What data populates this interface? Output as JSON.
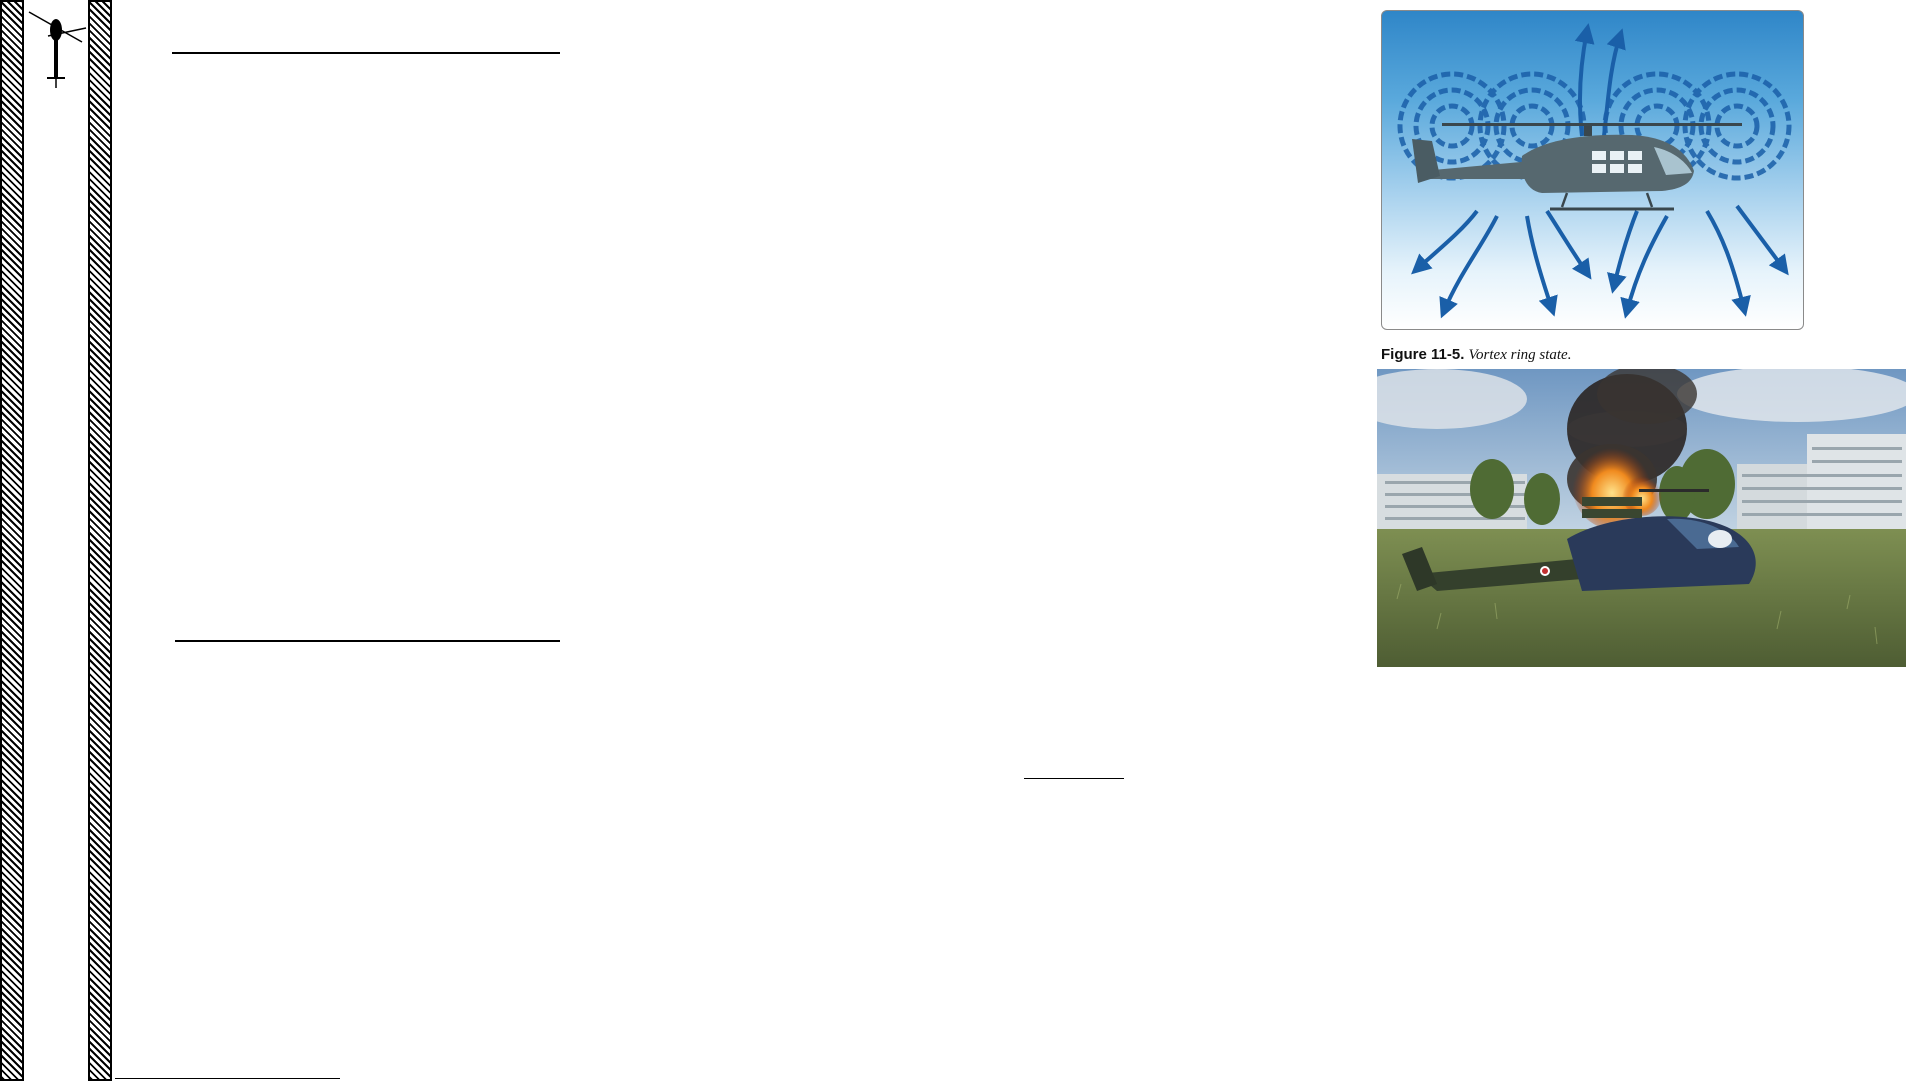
{
  "figure": {
    "label": "Figure 11-5.",
    "caption": "Vortex ring state."
  },
  "icons": {
    "margin_icon": "helicopter-silhouette-icon"
  },
  "colors": {
    "hatch": "#000000",
    "sky_top": "#2f86c8",
    "sky_bottom": "#e6f3fb",
    "arrow": "#1a5fa8",
    "helicopter": "#4e6068"
  }
}
